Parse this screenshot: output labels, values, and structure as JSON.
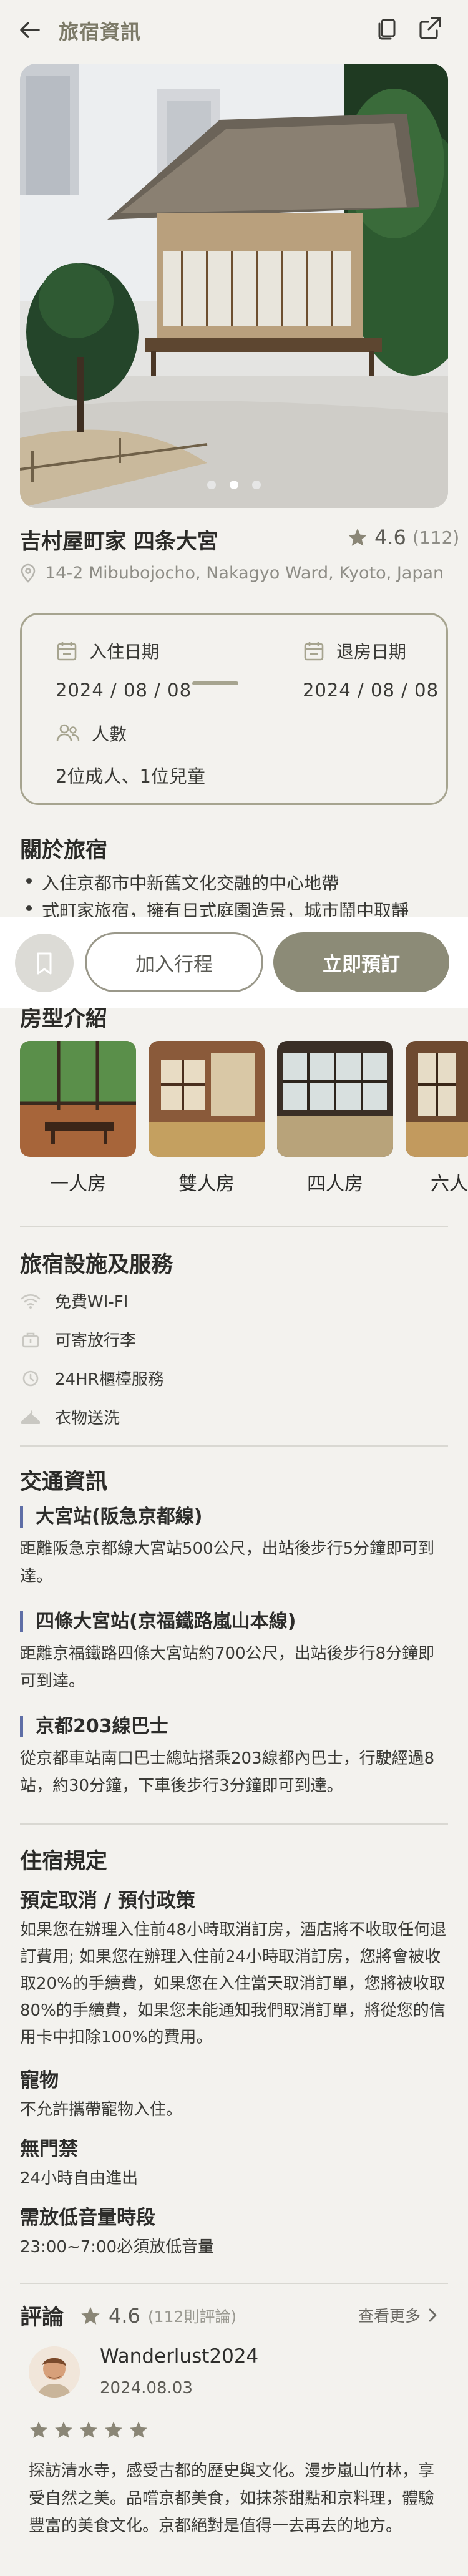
{
  "header": {
    "title": "旅宿資訊"
  },
  "hotel": {
    "name": "吉村屋町家 四条大宮",
    "rating": "4.6",
    "rating_count": "(112)",
    "address": "14-2 Mibubojocho, Nakagyo Ward, Kyoto, Japan",
    "carousel_index": 1,
    "carousel_total": 3
  },
  "dates": {
    "checkin_label": "入住日期",
    "checkin_value": "2024 / 08 / 08",
    "checkout_label": "退房日期",
    "checkout_value": "2024 / 08 / 08",
    "guests_label": "人數",
    "guests_value": "2位成人、1位兒童"
  },
  "about": {
    "title": "關於旅宿",
    "items": [
      "入住京都市中新舊文化交融的中心地帶",
      "式町家旅宿，擁有日式庭園造景，城市鬧中取靜"
    ]
  },
  "actions": {
    "add_label": "加入行程",
    "book_label": "立即預訂"
  },
  "rooms": {
    "title": "房型介紹",
    "items": [
      {
        "name": "一人房"
      },
      {
        "name": "雙人房"
      },
      {
        "name": "四人房"
      },
      {
        "name": "六人房"
      }
    ]
  },
  "facilities": {
    "title": "旅宿設施及服務",
    "items": [
      {
        "label": "免費WI-FI",
        "icon": "wifi-icon"
      },
      {
        "label": "可寄放行李",
        "icon": "luggage-icon"
      },
      {
        "label": "24HR櫃檯服務",
        "icon": "clock-icon"
      },
      {
        "label": "衣物送洗",
        "icon": "laundry-icon"
      }
    ]
  },
  "transport": {
    "title": "交通資訊",
    "items": [
      {
        "name": "大宮站(阪急京都線)",
        "desc": "距離阪急京都線大宮站500公尺，出站後步行5分鐘即可到達。"
      },
      {
        "name": "四條大宮站(京福鐵路嵐山本線)",
        "desc": "距離京福鐵路四條大宮站約700公尺，出站後步行8分鐘即可到達。"
      },
      {
        "name": "京都203線巴士",
        "desc": "從京都車站南口巴士總站搭乘203線都內巴士，行駛經過8站，約30分鐘，下車後步行3分鐘即可到達。"
      }
    ]
  },
  "rules": {
    "title": "住宿規定",
    "items": [
      {
        "name": "預定取消 / 預付政策",
        "desc": "如果您在辦理入住前48小時取消訂房，酒店將不收取任何退訂費用; 如果您在辦理入住前24小時取消訂房，您將會被收取20%的手續費，如果您在入住當天取消訂單，您將被收取80%的手續費，如果您未能通知我們取消訂單，將從您的信用卡中扣除100%的費用。"
      },
      {
        "name": "寵物",
        "desc": "不允許攜帶寵物入住。"
      },
      {
        "name": "無門禁",
        "desc": "24小時自由進出"
      },
      {
        "name": "需放低音量時段",
        "desc": "23:00~7:00必須放低音量"
      }
    ]
  },
  "reviews": {
    "title": "評論",
    "rating": "4.6",
    "count": "(112則評論)",
    "more_label": "查看更多",
    "first": {
      "user": "Wanderlust2024",
      "date": "2024.08.03",
      "stars": 5,
      "text": "探訪清水寺，感受古都的歷史與文化。漫步嵐山竹林，享受自然之美。品嚐京都美食，如抹茶甜點和京料理，體驗豐富的美食文化。京都絕對是值得一去再去的地方。"
    }
  },
  "colors": {
    "accent": "#8c8b77",
    "accent_border": "#a6a48f",
    "transport_bar": "#5e6ea6",
    "star": "#8a8676"
  }
}
